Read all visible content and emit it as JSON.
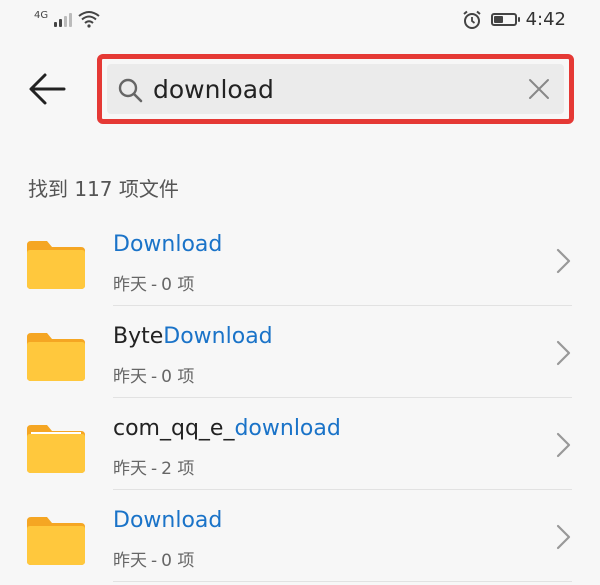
{
  "status_bar": {
    "network": "4G",
    "time": "4:42",
    "battery_level": 0.45,
    "icons": [
      "signal-icon",
      "wifi-icon",
      "alarm-icon",
      "battery-icon"
    ]
  },
  "search": {
    "value": "download",
    "placeholder": ""
  },
  "results": {
    "count_label": "找到 117 项文件",
    "items": [
      {
        "name_prefix": "",
        "name_highlight": "Download",
        "date": "昨天",
        "count": "0 项"
      },
      {
        "name_prefix": "Byte",
        "name_highlight": "Download",
        "date": "昨天",
        "count": "0 项"
      },
      {
        "name_prefix": "com_qq_e_",
        "name_highlight": "download",
        "date": "昨天",
        "count": "2 项"
      },
      {
        "name_prefix": "",
        "name_highlight": "Download",
        "date": "昨天",
        "count": "0 项"
      }
    ]
  },
  "colors": {
    "highlight": "#1a73c8",
    "annotation_border": "#e53935",
    "folder": "#ffc83d"
  }
}
